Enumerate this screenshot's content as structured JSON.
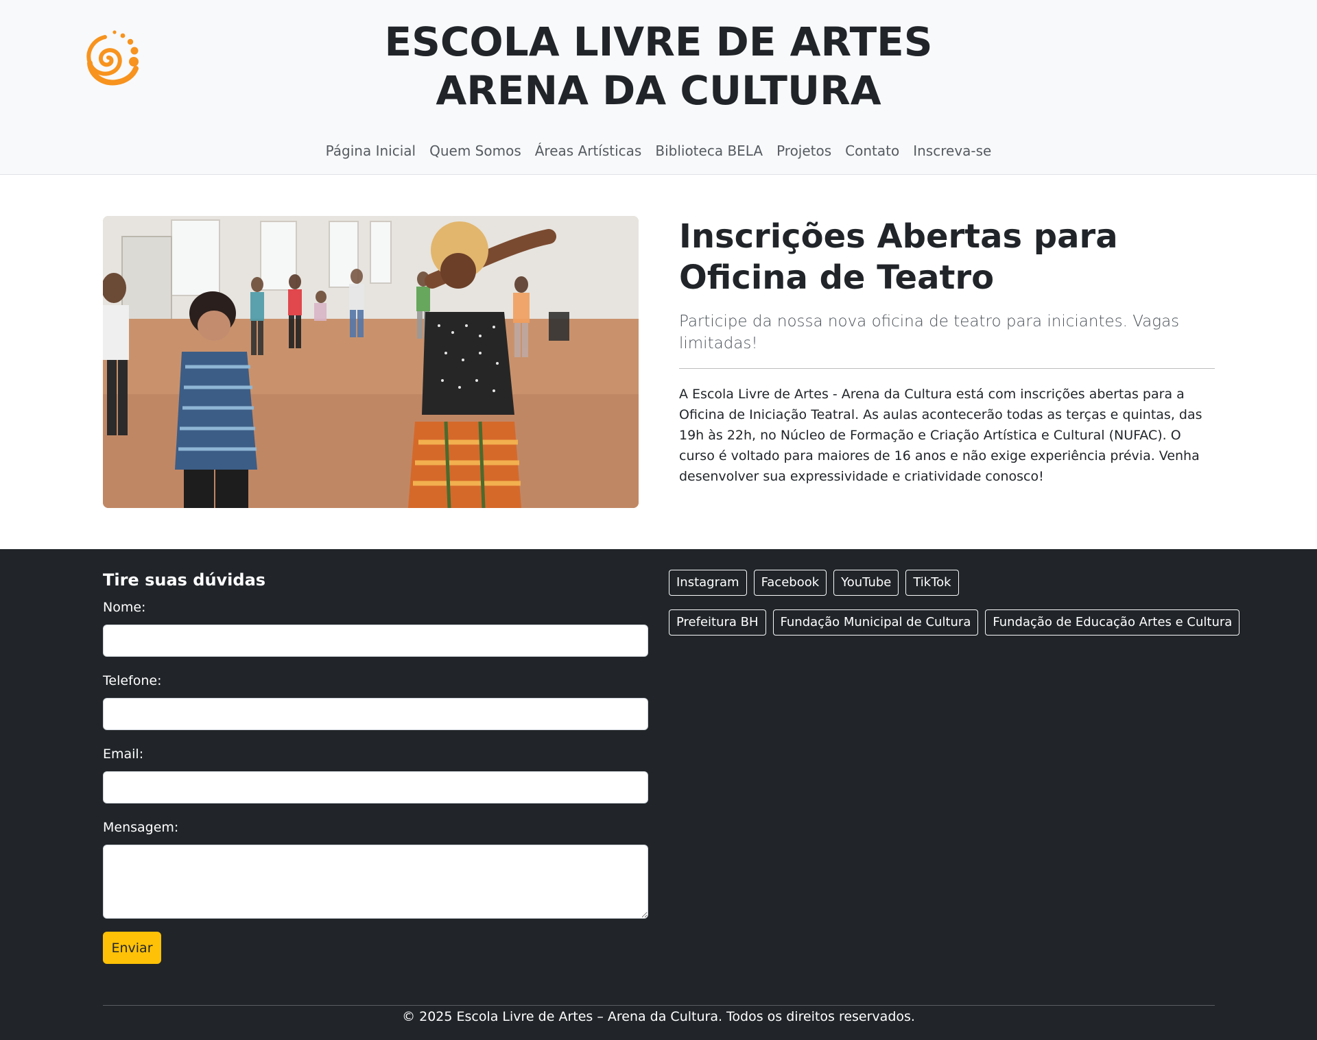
{
  "header": {
    "title_line1": "ESCOLA LIVRE DE ARTES",
    "title_line2": "ARENA DA CULTURA",
    "logo_icon": "spiral-logo-icon",
    "nav": [
      {
        "label": "Página Inicial"
      },
      {
        "label": "Quem Somos"
      },
      {
        "label": "Áreas Artísticas"
      },
      {
        "label": "Biblioteca BELA"
      },
      {
        "label": "Projetos"
      },
      {
        "label": "Contato"
      },
      {
        "label": "Inscreva-se"
      }
    ]
  },
  "hero": {
    "title": "Inscrições Abertas para Oficina de Teatro",
    "lead": "Participe da nossa nova oficina de teatro para iniciantes. Vagas limitadas!",
    "body": "A Escola Livre de Artes - Arena da Cultura está com inscrições abertas para a Oficina de Iniciação Teatral. As aulas acontecerão todas as terças e quintas, das 19h às 22h, no Núcleo de Formação e Criação Artística e Cultural (NUFAC). O curso é voltado para maiores de 16 anos e não exige experiência prévia. Venha desenvolver sua expressividade e criatividade conosco!",
    "image": "theater-workshop-photo"
  },
  "contact_form": {
    "title": "Tire suas dúvidas",
    "name_label": "Nome:",
    "name_value": "",
    "phone_label": "Telefone:",
    "phone_value": "",
    "email_label": "Email:",
    "email_value": "",
    "message_label": "Mensagem:",
    "message_value": "",
    "submit_label": "Enviar"
  },
  "social_links": [
    {
      "label": "Instagram"
    },
    {
      "label": "Facebook"
    },
    {
      "label": "YouTube"
    },
    {
      "label": "TikTok"
    }
  ],
  "partner_links": [
    {
      "label": "Prefeitura BH"
    },
    {
      "label": "Fundação Municipal de Cultura"
    },
    {
      "label": "Fundação de Educação Artes e Cultura"
    }
  ],
  "footer": {
    "copyright": "© 2025 Escola Livre de Artes – Arena da Cultura. Todos os direitos reservados."
  },
  "colors": {
    "accent": "#f7931e",
    "button": "#ffc107",
    "footer_bg": "#212529",
    "header_bg": "#f8f9fa"
  }
}
